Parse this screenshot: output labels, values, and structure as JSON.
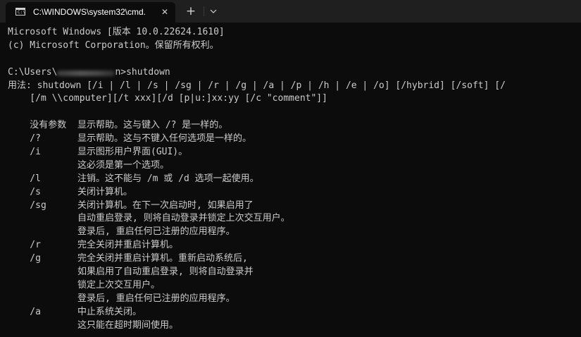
{
  "tab": {
    "title": "C:\\WINDOWS\\system32\\cmd.",
    "icon": "cmd-icon",
    "close_glyph": "✕"
  },
  "toolbar": {
    "new_tab_glyph": "+",
    "dropdown_icon": "chevron-down-icon"
  },
  "console": {
    "banner_line1": "Microsoft Windows [版本 10.0.22624.1610]",
    "banner_line2": "(c) Microsoft Corporation。保留所有权利。",
    "prompt_prefix": "C:\\Users\\",
    "prompt_suffix": "n>shutdown",
    "usage_line1": "用法: shutdown [/i | /l | /s | /sg | /r | /g | /a | /p | /h | /e | /o] [/hybrid] [/soft] [/",
    "usage_line2": "    [/m \\\\computer][/t xxx][/d [p|u:]xx:yy [/c \"comment\"]]",
    "options": [
      {
        "opt": "    没有参数",
        "desc": "显示帮助。这与键入 /? 是一样的。"
      },
      {
        "opt": "    /?",
        "desc": "显示帮助。这与不键入任何选项是一样的。"
      },
      {
        "opt": "    /i",
        "desc": "显示图形用户界面(GUI)。"
      },
      {
        "opt": "",
        "desc": "这必须是第一个选项。"
      },
      {
        "opt": "    /l",
        "desc": "注销。这不能与 /m 或 /d 选项一起使用。"
      },
      {
        "opt": "    /s",
        "desc": "关闭计算机。"
      },
      {
        "opt": "    /sg",
        "desc": "关闭计算机。在下一次启动时, 如果启用了"
      },
      {
        "opt": "",
        "desc": "自动重启登录, 则将自动登录并锁定上次交互用户。"
      },
      {
        "opt": "",
        "desc": "登录后, 重启任何已注册的应用程序。"
      },
      {
        "opt": "    /r",
        "desc": "完全关闭并重启计算机。"
      },
      {
        "opt": "    /g",
        "desc": "完全关闭并重启计算机。重新启动系统后,"
      },
      {
        "opt": "",
        "desc": "如果启用了自动重启登录, 则将自动登录并"
      },
      {
        "opt": "",
        "desc": "锁定上次交互用户。"
      },
      {
        "opt": "",
        "desc": "登录后, 重启任何已注册的应用程序。"
      },
      {
        "opt": "    /a",
        "desc": "中止系统关闭。"
      },
      {
        "opt": "",
        "desc": "这只能在超时期间使用。"
      }
    ]
  }
}
